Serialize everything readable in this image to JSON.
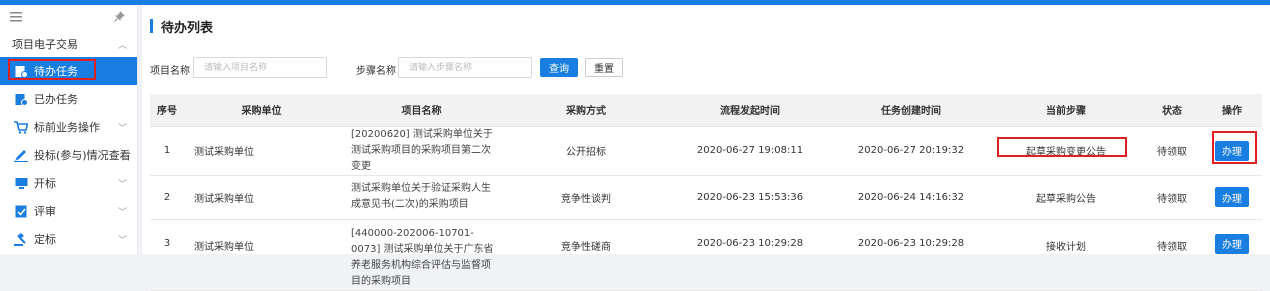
{
  "sidebar": {
    "menu_icon": "hamburger-icon",
    "pin_icon": "pin-icon",
    "group_label": "项目电子交易",
    "items": [
      {
        "label": "待办任务",
        "icon": "todo-icon",
        "active": true
      },
      {
        "label": "已办任务",
        "icon": "done-icon"
      },
      {
        "label": "标前业务操作",
        "icon": "cart-icon"
      },
      {
        "label": "投标(参与)情况查看",
        "icon": "pen-icon"
      },
      {
        "label": "开标",
        "icon": "monitor-icon"
      },
      {
        "label": "评审",
        "icon": "review-icon"
      },
      {
        "label": "定标",
        "icon": "gavel-icon"
      }
    ]
  },
  "main": {
    "title": "待办列表",
    "search": {
      "project_label": "项目名称",
      "project_placeholder": "请输入项目名称",
      "step_label": "步骤名称",
      "step_placeholder": "请输入步骤名称",
      "query_label": "查询",
      "reset_label": "重置"
    },
    "table": {
      "headers": [
        "序号",
        "采购单位",
        "项目名称",
        "采购方式",
        "流程发起时间",
        "任务创建时间",
        "当前步骤",
        "状态",
        "操作"
      ],
      "rows": [
        {
          "no": "1",
          "unit": "测试采购单位",
          "name": "[20200620] 测试采购单位关于测试采购项目的采购项目第二次变更",
          "method": "公开招标",
          "flow_time": "2020-06-27 19:08:11",
          "task_time": "2020-06-27 20:19:32",
          "step": "起草采购变更公告",
          "status": "待领取",
          "action": "办理"
        },
        {
          "no": "2",
          "unit": "测试采购单位",
          "name": "测试采购单位关于验证采购人生成意见书(二次)的采购项目",
          "method": "竞争性谈判",
          "flow_time": "2020-06-23 15:53:36",
          "task_time": "2020-06-24 14:16:32",
          "step": "起草采购公告",
          "status": "待领取",
          "action": "办理"
        },
        {
          "no": "3",
          "unit": "测试采购单位",
          "name": "[440000-202006-10701-0073] 测试采购单位关于广东省养老服务机构综合评估与监督项目的采购项目",
          "method": "竞争性磋商",
          "flow_time": "2020-06-23 10:29:28",
          "task_time": "2020-06-23 10:29:28",
          "step": "接收计划",
          "status": "待领取",
          "action": "办理"
        }
      ]
    }
  },
  "colors": {
    "accent": "#1a7ee0",
    "highlight": "#e02020"
  }
}
